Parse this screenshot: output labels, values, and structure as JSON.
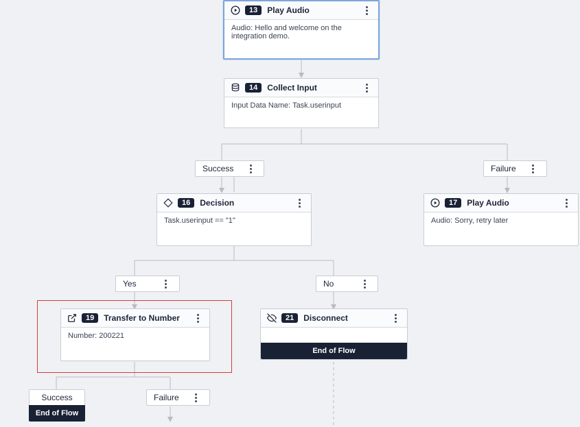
{
  "nodes": {
    "play13": {
      "num": "13",
      "title": "Play Audio",
      "body": "Audio: Hello and welcome on the integration demo."
    },
    "collect14": {
      "num": "14",
      "title": "Collect Input",
      "body": "Input Data Name: Task.userinput"
    },
    "decision16": {
      "num": "16",
      "title": "Decision",
      "body": "Task.userinput == \"1\""
    },
    "play17": {
      "num": "17",
      "title": "Play Audio",
      "body": "Audio: Sorry, retry later"
    },
    "transfer19": {
      "num": "19",
      "title": "Transfer to Number",
      "body": "Number: 200221"
    },
    "disconnect21": {
      "num": "21",
      "title": "Disconnect",
      "endflow": "End of Flow"
    }
  },
  "labels": {
    "success1": "Success",
    "failure1": "Failure",
    "yes": "Yes",
    "no": "No",
    "success2": "Success",
    "failure2": "Failure"
  },
  "endflow2": "End of Flow"
}
